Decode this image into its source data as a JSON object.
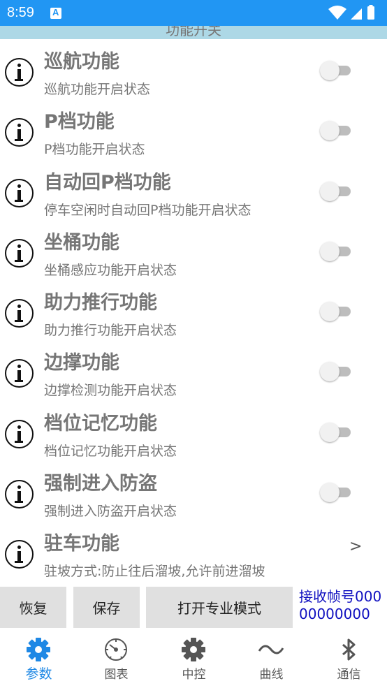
{
  "status_bar": {
    "time": "8:59",
    "notification_icon": "A"
  },
  "section_header": "功能开关",
  "settings": [
    {
      "title": "巡航功能",
      "desc": "巡航功能开启状态",
      "control": "switch",
      "on": false
    },
    {
      "title": "P档功能",
      "desc": "P档功能开启状态",
      "control": "switch",
      "on": false
    },
    {
      "title": "自动回P档功能",
      "desc": "停车空闲时自动回P档功能开启状态",
      "control": "switch",
      "on": false
    },
    {
      "title": "坐桶功能",
      "desc": "坐桶感应功能开启状态",
      "control": "switch",
      "on": false
    },
    {
      "title": "助力推行功能",
      "desc": "助力推行功能开启状态",
      "control": "switch",
      "on": false
    },
    {
      "title": "边撑功能",
      "desc": "边撑检测功能开启状态",
      "control": "switch",
      "on": false
    },
    {
      "title": "档位记忆功能",
      "desc": "档位记忆功能开启状态",
      "control": "switch",
      "on": false
    },
    {
      "title": "强制进入防盗",
      "desc": "强制进入防盗开启状态",
      "control": "switch",
      "on": false
    },
    {
      "title": "驻车功能",
      "desc": "驻坡方式:防止往后溜坡,允许前进溜坡",
      "control": "chevron",
      "chevron": ">"
    }
  ],
  "buttons": {
    "restore": "恢复",
    "save": "保存",
    "pro_mode": "打开专业模式"
  },
  "frame_info": "接收帧号00000000000",
  "tabs": [
    {
      "label": "参数",
      "icon": "gear-icon",
      "active": true
    },
    {
      "label": "图表",
      "icon": "gauge-icon",
      "active": false
    },
    {
      "label": "中控",
      "icon": "gear-icon",
      "active": false
    },
    {
      "label": "曲线",
      "icon": "wave-icon",
      "active": false
    },
    {
      "label": "通信",
      "icon": "bluetooth-icon",
      "active": false
    }
  ],
  "colors": {
    "status_bar": "#2196f3",
    "section_header": "#add8e6",
    "active_tab": "#1e88e5",
    "frame_info": "#1010c0"
  }
}
